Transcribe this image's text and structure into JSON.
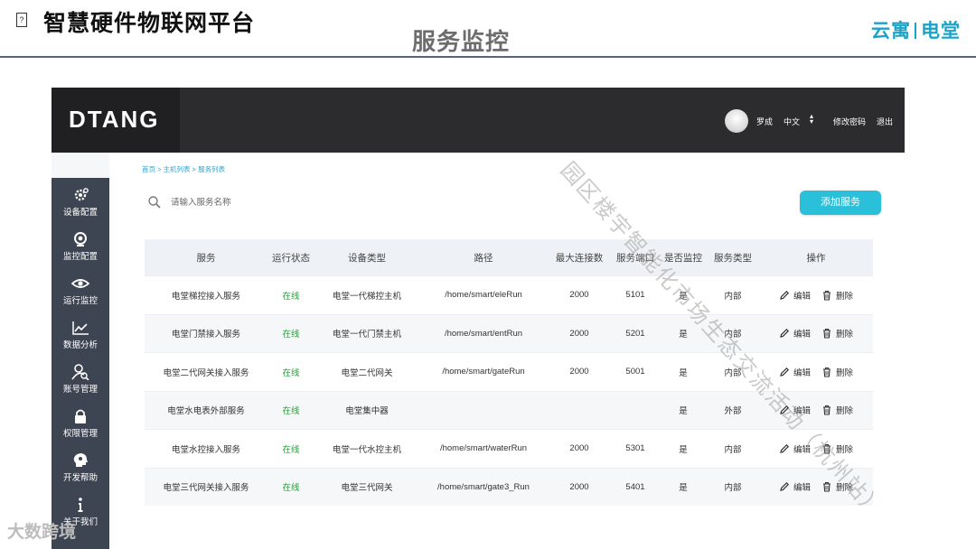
{
  "slide": {
    "title": "智慧硬件物联网平台",
    "subtitle": "服务监控",
    "brand_left": "云寓",
    "brand_right": "电堂",
    "icon_glyph": "?"
  },
  "app": {
    "logo": "DTANG",
    "user_name": "罗成",
    "language": "中文",
    "change_password": "修改密码",
    "logout": "退出",
    "breadcrumb": "首页 > 主机列表 > 服务列表",
    "search_placeholder": "请输入服务名称",
    "add_button": "添加服务",
    "sidebar": [
      {
        "label": "设备配置",
        "icon": "gear-icon"
      },
      {
        "label": "监控配置",
        "icon": "webcam-icon"
      },
      {
        "label": "运行监控",
        "icon": "eye-icon"
      },
      {
        "label": "数据分析",
        "icon": "line-chart-icon"
      },
      {
        "label": "账号管理",
        "icon": "user-search-icon"
      },
      {
        "label": "权限管理",
        "icon": "lock-icon"
      },
      {
        "label": "开发帮助",
        "icon": "brain-icon"
      },
      {
        "label": "关于我们",
        "icon": "info-icon"
      }
    ],
    "table": {
      "headers": [
        "服务",
        "运行状态",
        "设备类型",
        "路径",
        "最大连接数",
        "服务端口",
        "是否监控",
        "服务类型",
        "操作"
      ],
      "edit_label": "编辑",
      "delete_label": "删除",
      "rows": [
        [
          "电堂梯控接入服务",
          "在线",
          "电堂一代梯控主机",
          "/home/smart/eleRun",
          "2000",
          "5101",
          "是",
          "内部"
        ],
        [
          "电堂门禁接入服务",
          "在线",
          "电堂一代门禁主机",
          "/home/smart/entRun",
          "2000",
          "5201",
          "是",
          "内部"
        ],
        [
          "电堂二代网关接入服务",
          "在线",
          "电堂二代网关",
          "/home/smart/gateRun",
          "2000",
          "5001",
          "是",
          "内部"
        ],
        [
          "电堂水电表外部服务",
          "在线",
          "电堂集中器",
          "",
          "",
          "",
          "是",
          "外部"
        ],
        [
          "电堂水控接入服务",
          "在线",
          "电堂一代水控主机",
          "/home/smart/waterRun",
          "2000",
          "5301",
          "是",
          "内部"
        ],
        [
          "电堂三代网关接入服务",
          "在线",
          "电堂三代网关",
          "/home/smart/gate3_Run",
          "2000",
          "5401",
          "是",
          "内部"
        ]
      ]
    }
  },
  "overlay": {
    "diagonal_watermark": "园区楼宇智能化市场生态交流活动（杭州站）",
    "bottom_watermark": "大数跨境"
  },
  "colors": {
    "accent": "#2ac0da",
    "brand": "#1aa3c7",
    "online": "#2a9d3a",
    "sidebar": "#3d4552",
    "topbar": "#2c2c2e"
  }
}
